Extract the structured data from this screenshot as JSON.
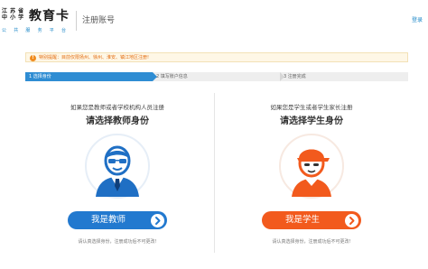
{
  "header": {
    "logo_province": [
      "江 苏 省",
      "中 小 学"
    ],
    "logo_brand": "教育卡",
    "logo_tagline": "公 共 服 务 平 台",
    "page_title": "注册账号",
    "login_link": "登录"
  },
  "notice": {
    "text": "特别提醒：目前仅限扬州、徐州、淮安、镇江地区注册!"
  },
  "steps": [
    {
      "label": "1 选择身份"
    },
    {
      "label": "2 填写账户信息"
    },
    {
      "label": "3 注册完成"
    }
  ],
  "teacher": {
    "subtitle": "如果您是教师或者学校机构人员注册",
    "title": "请选择教师身份",
    "button": "我是教师",
    "note": "请认真选择身份，注册成功后不可更改!"
  },
  "student": {
    "subtitle": "如果您是学生或者学生家长注册",
    "title": "请选择学生身份",
    "button": "我是学生",
    "note": "请认真选择身份，注册成功后不可更改!"
  },
  "colors": {
    "accent_blue": "#2279cf",
    "accent_orange": "#f25a1d",
    "step_active": "#2f8dd3",
    "notice_text": "#e36d10"
  },
  "icons": {
    "teacher_avatar": "teacher-avatar-icon",
    "student_avatar": "student-avatar-icon",
    "button_arrow": "chevron-right-icon",
    "notice": "warning-icon"
  }
}
